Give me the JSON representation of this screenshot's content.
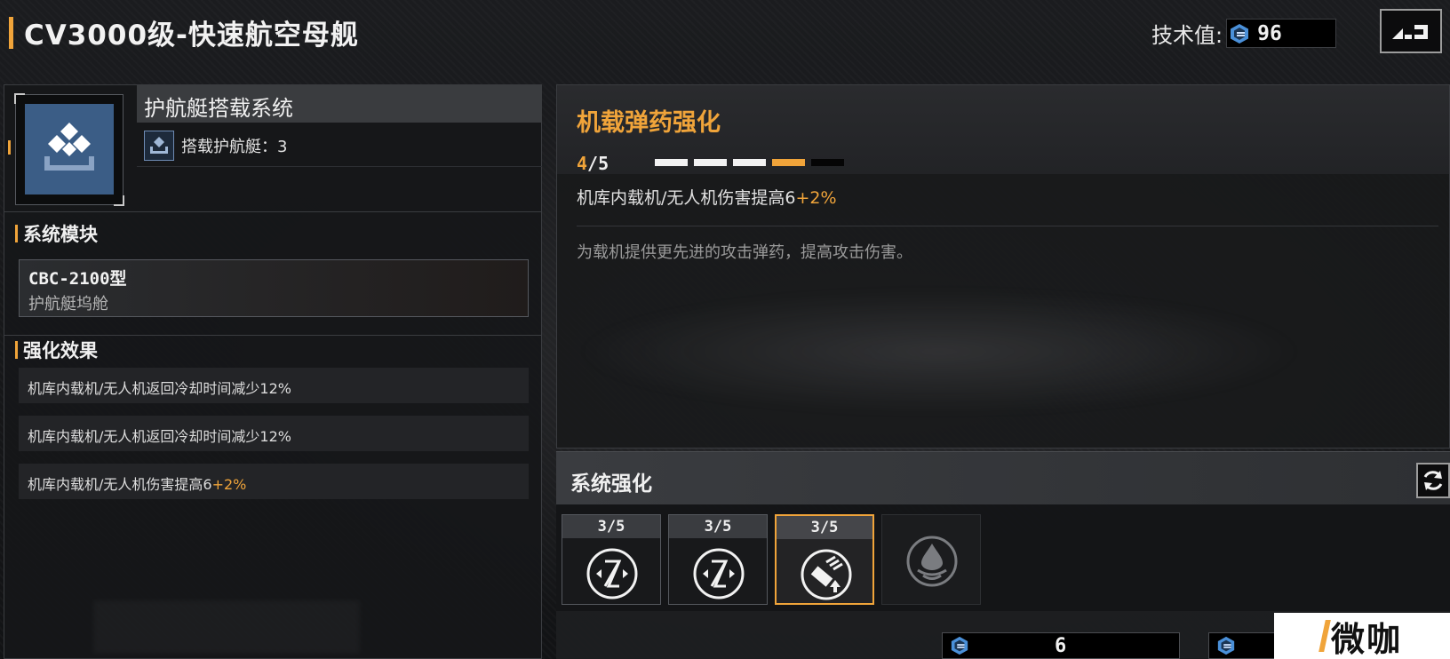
{
  "header": {
    "title": "CV3000级-快速航空母舰",
    "tech_label": "技术值:",
    "tech_value": "96"
  },
  "left_panel": {
    "system_name": "护航艇搭载系统",
    "carry_label": "搭载护航艇：3",
    "modules_heading": "系统模块",
    "module": {
      "name": "CBC-2100型",
      "sub": "护航艇坞舱"
    },
    "effects_heading": "强化效果",
    "effects": [
      {
        "text": "机库内载机/无人机返回冷却时间减少12%",
        "plus": ""
      },
      {
        "text": "机库内载机/无人机返回冷却时间减少12%",
        "plus": ""
      },
      {
        "text": "机库内载机/无人机伤害提高6",
        "plus": "+2%"
      }
    ]
  },
  "detail": {
    "title": "机载弹药强化",
    "level_current": "4",
    "level_rest": "/5",
    "progress": {
      "filled": 3,
      "next": 1,
      "total": 5
    },
    "effect_text": "机库内载机/无人机伤害提高6",
    "effect_plus": "+2%",
    "description": "为载机提供更先进的攻击弹药，提高攻击伤害。"
  },
  "enhance": {
    "title": "系统强化",
    "slots": [
      {
        "count": "3/5",
        "icon": "cooldown-reduction-icon",
        "state": "normal"
      },
      {
        "count": "3/5",
        "icon": "cooldown-reduction-icon",
        "state": "normal"
      },
      {
        "count": "3/5",
        "icon": "ammo-upgrade-icon",
        "state": "selected"
      },
      {
        "count": "",
        "icon": "locked-drop-icon",
        "state": "locked"
      }
    ]
  },
  "costs": [
    {
      "icon": "tech-gem-icon",
      "value": "6"
    },
    {
      "icon": "tech-gem-icon",
      "value": ""
    }
  ],
  "watermark": {
    "text": "微咖"
  },
  "colors": {
    "accent": "#f0a43a",
    "panel": "#18191b",
    "icon_blue": "#3b5d86",
    "gem_blue": "#4a90d9"
  }
}
